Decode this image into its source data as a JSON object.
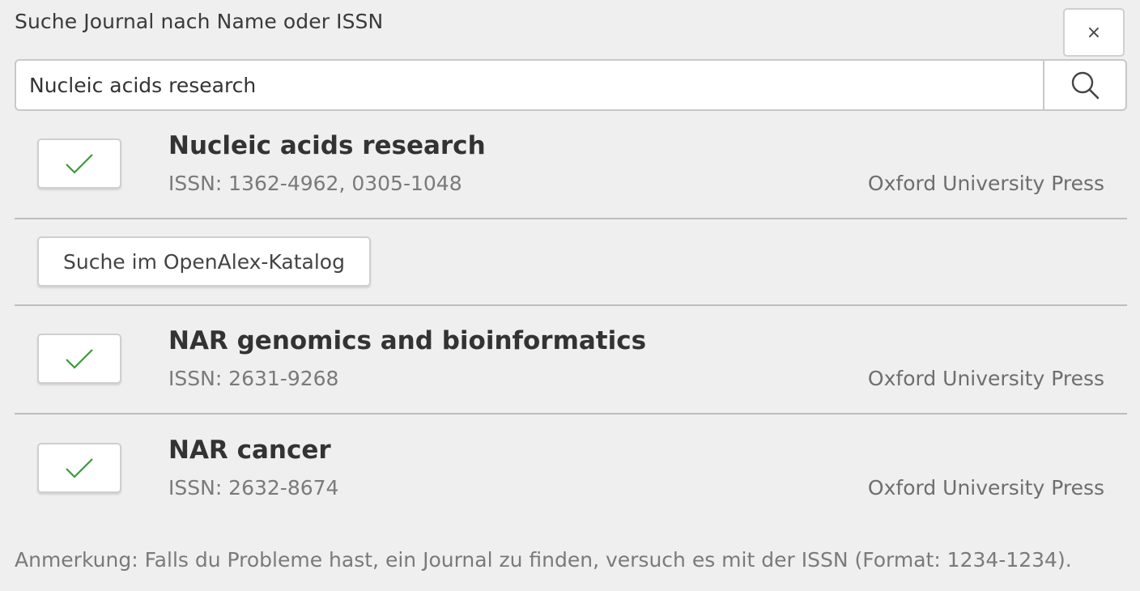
{
  "dialog": {
    "title": "Suche Journal nach Name oder ISSN",
    "close_label": "×"
  },
  "search": {
    "value": "Nucleic acids research",
    "placeholder": ""
  },
  "openalex_button": {
    "label": "Suche im OpenAlex-Katalog"
  },
  "results": [
    {
      "name": "Nucleic acids research",
      "issn": "ISSN: 1362-4962, 0305-1048",
      "publisher": "Oxford University Press",
      "selected": true
    },
    {
      "name": "NAR genomics and bioinformatics",
      "issn": "ISSN: 2631-9268",
      "publisher": "Oxford University Press",
      "selected": true
    },
    {
      "name": "NAR cancer",
      "issn": "ISSN: 2632-8674",
      "publisher": "Oxford University Press",
      "selected": true
    }
  ],
  "note": "Anmerkung: Falls du Probleme hast, ein Journal zu finden, versuch es mit der ISSN (Format: 1234-1234).",
  "colors": {
    "background": "#efefef",
    "check": "#3a9a3a",
    "divider": "#bdbdbd"
  },
  "icons": {
    "search": "search-icon",
    "check": "check-icon",
    "close": "close-icon"
  }
}
